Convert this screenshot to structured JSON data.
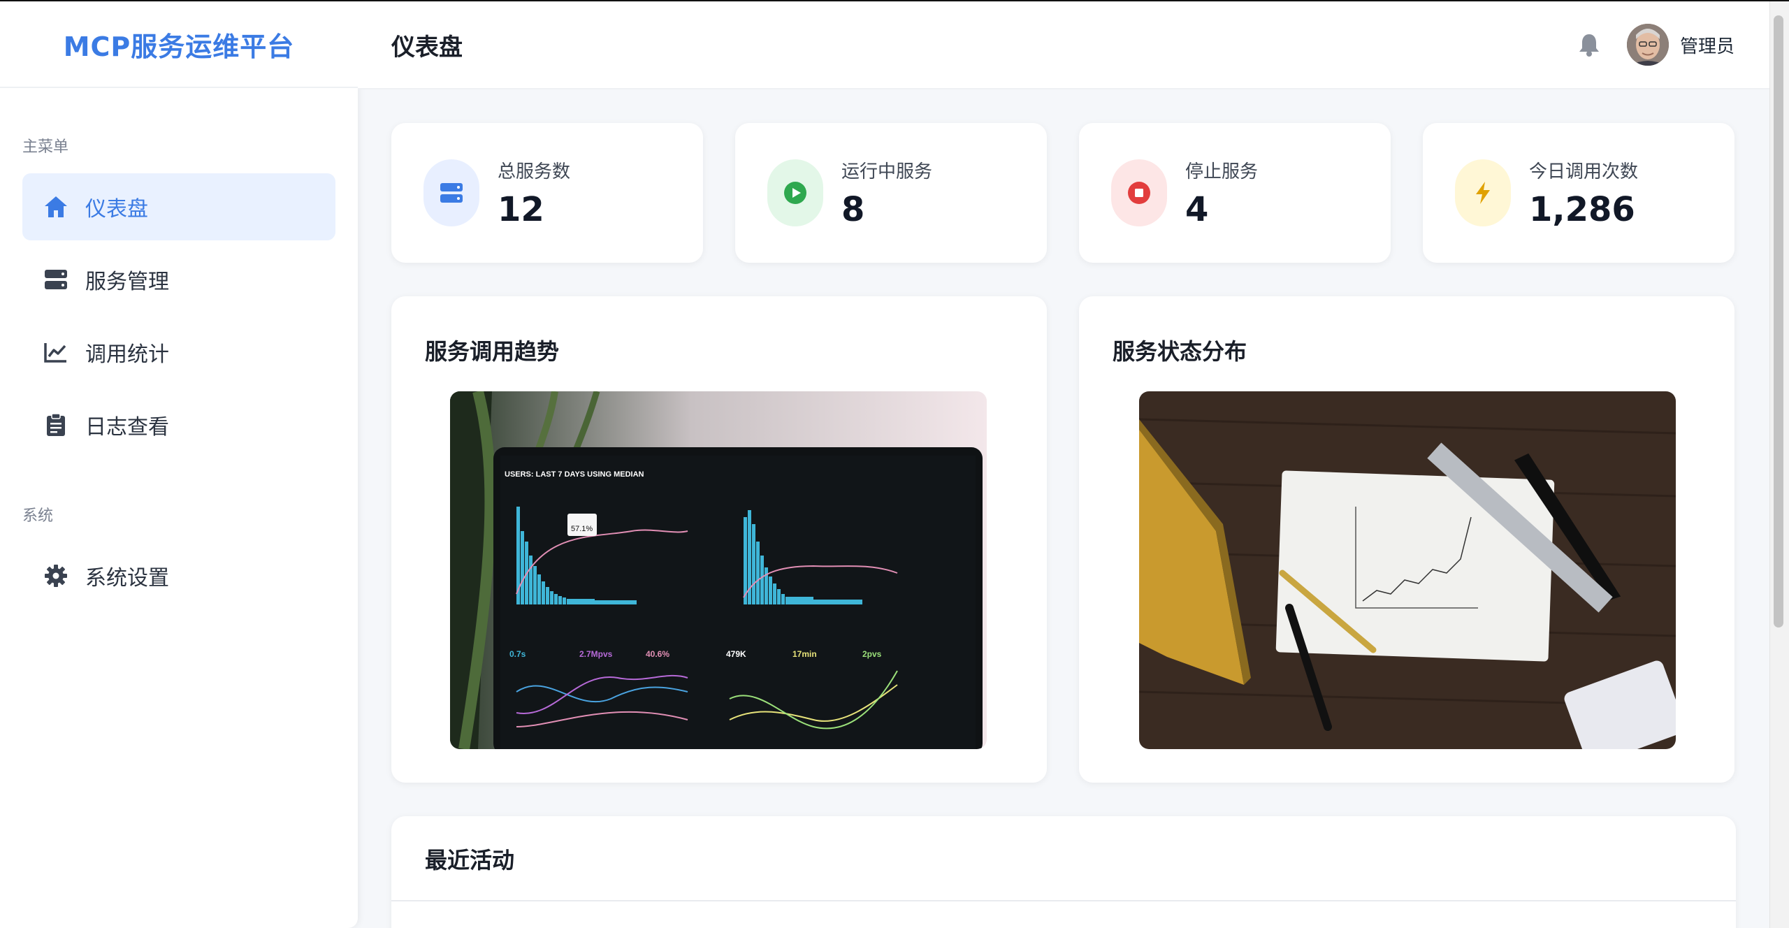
{
  "app": {
    "title": "MCP服务运维平台"
  },
  "header": {
    "page_title": "仪表盘",
    "username": "管理员"
  },
  "sidebar": {
    "main_section": "主菜单",
    "system_section": "系统",
    "items": [
      {
        "label": "仪表盘",
        "icon": "home-icon",
        "active": true
      },
      {
        "label": "服务管理",
        "icon": "server-icon",
        "active": false
      },
      {
        "label": "调用统计",
        "icon": "chart-line-icon",
        "active": false
      },
      {
        "label": "日志查看",
        "icon": "clipboard-icon",
        "active": false
      }
    ],
    "system_items": [
      {
        "label": "系统设置",
        "icon": "gear-icon",
        "active": false
      }
    ]
  },
  "stats": [
    {
      "label": "总服务数",
      "value": "12",
      "icon": "server-icon",
      "color": "#3b7be4",
      "bg": "#e8efff"
    },
    {
      "label": "运行中服务",
      "value": "8",
      "icon": "play-icon",
      "color": "#2fa84f",
      "bg": "#e3f7e8"
    },
    {
      "label": "停止服务",
      "value": "4",
      "icon": "stop-icon",
      "color": "#e23d3d",
      "bg": "#fde6e6"
    },
    {
      "label": "今日调用次数",
      "value": "1,286",
      "icon": "bolt-icon",
      "color": "#e0a100",
      "bg": "#fff7d6"
    }
  ],
  "charts": {
    "trend": {
      "title": "服务调用趋势"
    },
    "status": {
      "title": "服务状态分布"
    }
  },
  "activity": {
    "title": "最近活动"
  },
  "laptop_screen": {
    "heading": "USERS: LAST 7 DAYS USING MEDIAN",
    "tooltip": "57.1%",
    "metrics": [
      "0.7s",
      "2.7Mpvs",
      "40.6%",
      "479K",
      "17min",
      "2pvs"
    ]
  },
  "colors": {
    "accent": "#3b7be4",
    "sidebar_bg": "#ffffff",
    "page_bg": "#f5f7fa"
  }
}
